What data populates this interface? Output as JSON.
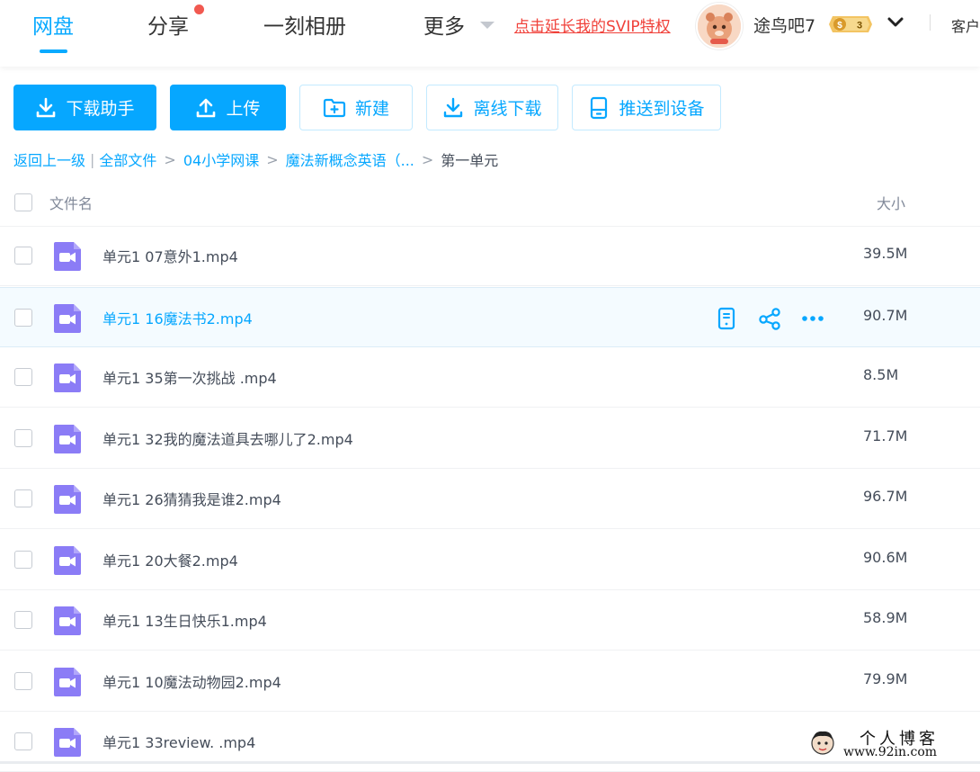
{
  "nav": {
    "tabs": [
      {
        "label": "网盘",
        "active": true
      },
      {
        "label": "分享",
        "has_dot": true
      },
      {
        "label": "一刻相册"
      },
      {
        "label": "更多"
      }
    ],
    "svip_link": "点击延长我的SVIP特权",
    "username": "途鸟吧7",
    "badge_level": "3",
    "client_label": "客户"
  },
  "toolbar": {
    "download_helper": "下载助手",
    "upload": "上传",
    "new_folder": "新建",
    "offline_download": "离线下载",
    "push_to_device": "推送到设备"
  },
  "breadcrumb": {
    "back": "返回上一级",
    "all_files": "全部文件",
    "level1": "04小学网课",
    "level2": "魔法新概念英语（...",
    "current": "第一单元"
  },
  "list": {
    "header_name": "文件名",
    "header_size": "大小",
    "files": [
      {
        "name": "单元1 07意外1.mp4",
        "size": "39.5M"
      },
      {
        "name": "单元1 16魔法书2.mp4",
        "size": "90.7M",
        "hovered": true
      },
      {
        "name": "单元1 35第一次挑战 .mp4",
        "size": "8.5M"
      },
      {
        "name": "单元1 32我的魔法道具去哪儿了2.mp4",
        "size": "71.7M"
      },
      {
        "name": "单元1 26猜猜我是谁2.mp4",
        "size": "96.7M"
      },
      {
        "name": "单元1 20大餐2.mp4",
        "size": "90.6M"
      },
      {
        "name": "单元1 13生日快乐1.mp4",
        "size": "58.9M"
      },
      {
        "name": "单元1 10魔法动物园2.mp4",
        "size": "79.9M"
      },
      {
        "name": "单元1 33review. .mp4",
        "size": ""
      }
    ]
  },
  "watermark": {
    "title": "个人博客",
    "url": "www.92in.com"
  },
  "colors": {
    "accent": "#06a7ff",
    "video_icon": "#8b7cf6",
    "svip_red": "#f0413a"
  }
}
